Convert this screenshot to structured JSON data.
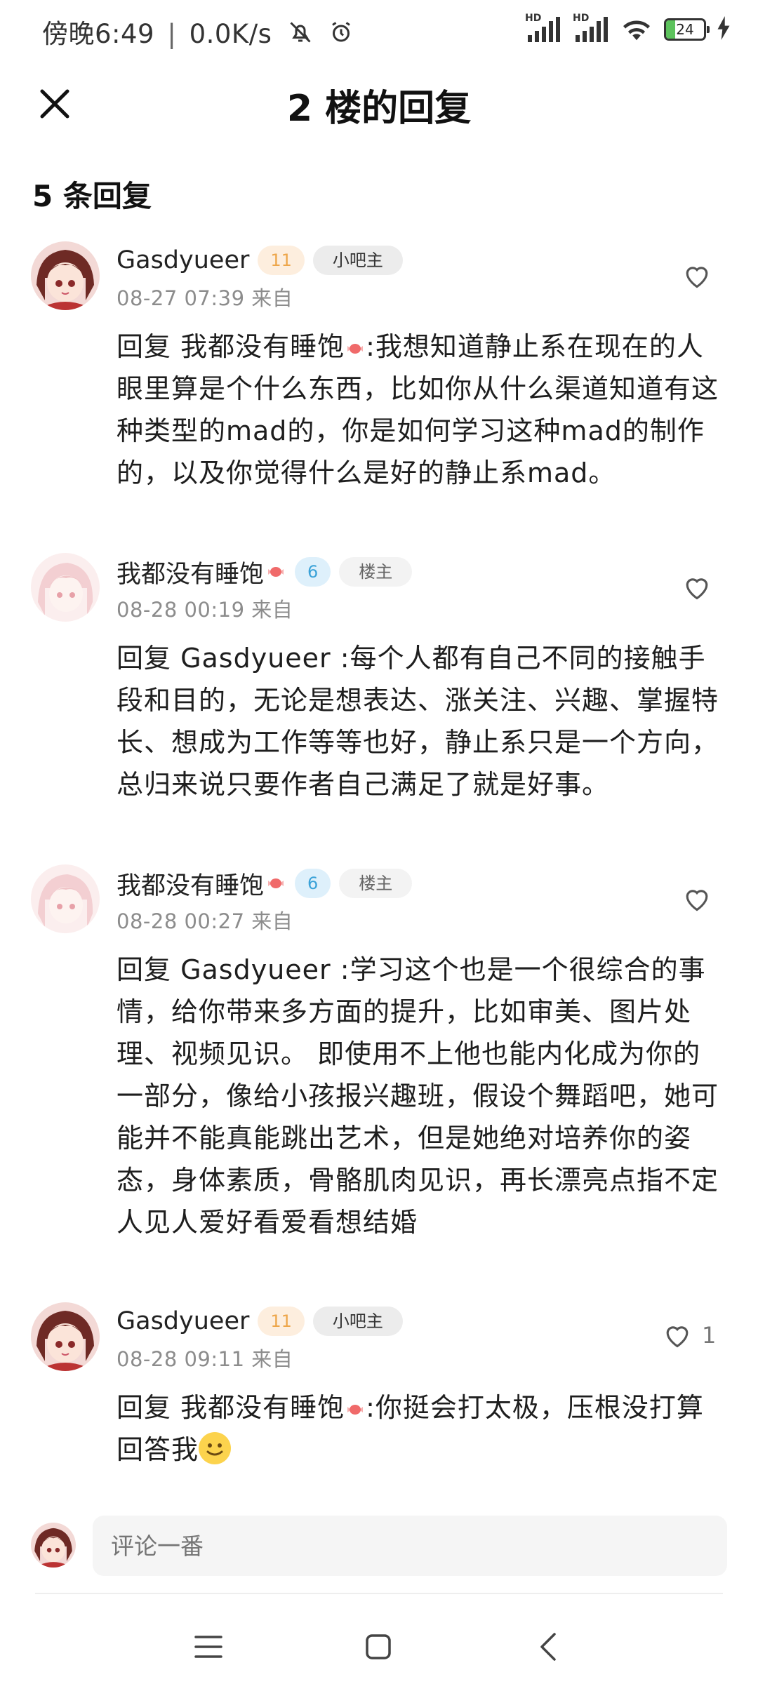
{
  "status_bar": {
    "time": "傍晚6:49",
    "speed": "0.0K/s",
    "network1": "HD",
    "network2": "HD",
    "battery": "24"
  },
  "header": {
    "title": "2 楼的回复"
  },
  "reply_count": "5 条回复",
  "replies": [
    {
      "username": "Gasdyueer",
      "level": "11",
      "badge": "小吧主",
      "time": "08-27 07:39",
      "source": "来自",
      "like_count": "",
      "content_prefix": "回复 我都没有睡饱",
      "content": ":我想知道静止系在现在的人眼里算是个什么东西，比如你从什么渠道知道有这种类型的mad的，你是如何学习这种mad的制作的，以及你觉得什么是好的静止系mad。"
    },
    {
      "username": "我都没有睡饱",
      "level": "6",
      "badge": "楼主",
      "time": "08-28 00:19",
      "source": "来自",
      "like_count": "",
      "content_prefix": "回复 Gasdyueer ",
      "content": ":每个人都有自己不同的接触手段和目的，无论是想表达、涨关注、兴趣、掌握特长、想成为工作等等也好，静止系只是一个方向，总归来说只要作者自己满足了就是好事。"
    },
    {
      "username": "我都没有睡饱",
      "level": "6",
      "badge": "楼主",
      "time": "08-28 00:27",
      "source": "来自",
      "like_count": "",
      "content_prefix": "回复 Gasdyueer ",
      "content": ":学习这个也是一个很综合的事情，给你带来多方面的提升，比如审美、图片处理、视频见识。 即使用不上他也能内化成为你的一部分，像给小孩报兴趣班，假设个舞蹈吧，她可能并不能真能跳出艺术，但是她绝对培养你的姿态，身体素质，骨骼肌肉见识，再长漂亮点指不定人见人爱好看爱看想结婚"
    },
    {
      "username": "Gasdyueer",
      "level": "11",
      "badge": "小吧主",
      "time": "08-28 09:11",
      "source": "来自",
      "like_count": "1",
      "content_prefix": "回复 我都没有睡饱",
      "content": ":你挺会打太极，压根没打算回答我"
    }
  ],
  "comment_bar": {
    "placeholder": "评论一番"
  },
  "icons": {
    "close": "close-icon",
    "like": "heart-outline-icon",
    "candy": "candy-icon",
    "emoji": "smile-emoji-icon",
    "nav_menu": "menu-icon",
    "nav_home": "square-home-icon",
    "nav_back": "back-chevron-icon"
  },
  "colors": {
    "level_orange_bg": "#fdeede",
    "level_orange_text": "#eda64a",
    "level_blue_bg": "#def0fb",
    "level_blue_text": "#3aa2d8",
    "battery_green": "#5cc25c"
  }
}
